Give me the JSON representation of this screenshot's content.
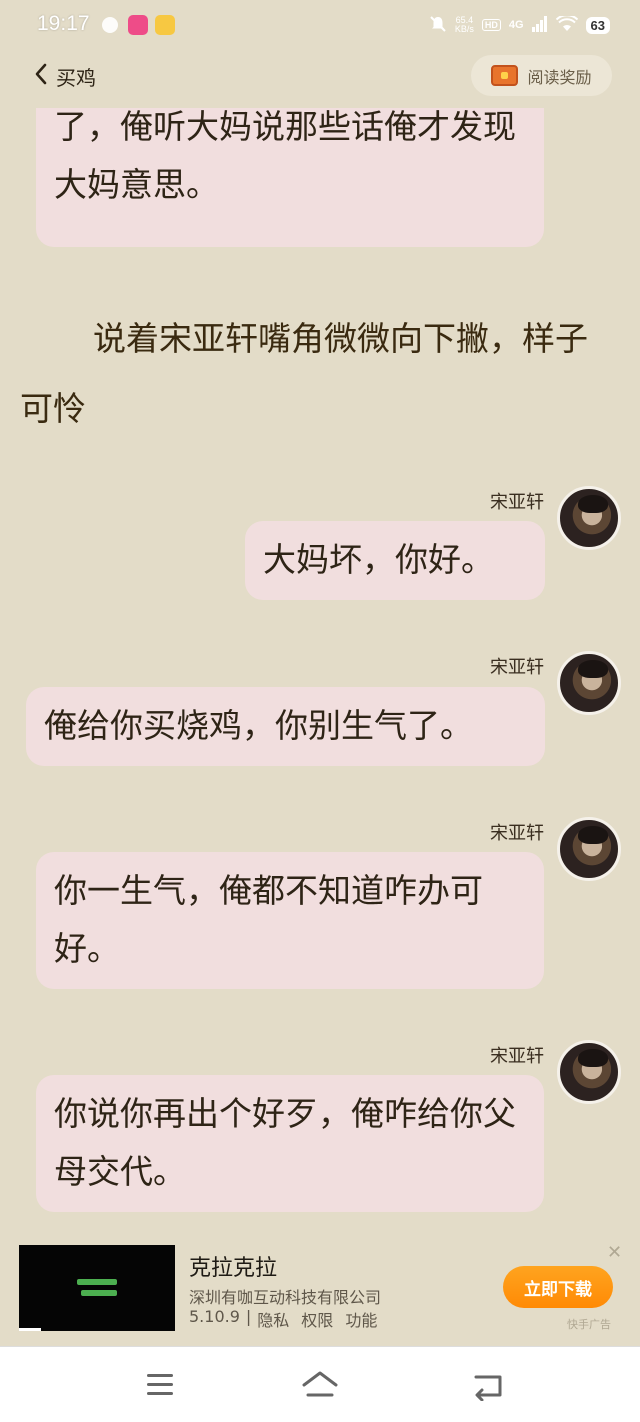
{
  "status": {
    "time": "19:17",
    "network_speed_value": "65.4",
    "network_speed_unit": "KB/s",
    "hd_label": "HD",
    "network_type": "4G",
    "battery": "63"
  },
  "header": {
    "back_label": "买鸡",
    "reward_label": "阅读奖励"
  },
  "story": {
    "partial_bubble": "了，俺听大妈说那些话俺才发现大妈意思。",
    "narration": "说着宋亚轩嘴角微微向下撇，样子可怜",
    "messages": [
      {
        "speaker": "宋亚轩",
        "text": "大妈坏，你好。"
      },
      {
        "speaker": "宋亚轩",
        "text": "俺给你买烧鸡，你别生气了。"
      },
      {
        "speaker": "宋亚轩",
        "text": "你一生气，俺都不知道咋办可好。"
      },
      {
        "speaker": "宋亚轩",
        "text": "你说你再出个好歹，俺咋给你父母交代。"
      }
    ]
  },
  "ad": {
    "title": "克拉克拉",
    "company": "深圳有咖互动科技有限公司",
    "version": "5.10.9",
    "separator": "|",
    "privacy": "隐私",
    "permissions": "权限",
    "features": "功能",
    "cta": "立即下载",
    "close": "✕",
    "source": "快手广告"
  },
  "nav": {
    "home_label": "home"
  },
  "colors": {
    "background": "#e3dcc8",
    "bubble": "#f1dede",
    "cta": "#ff9a10"
  }
}
